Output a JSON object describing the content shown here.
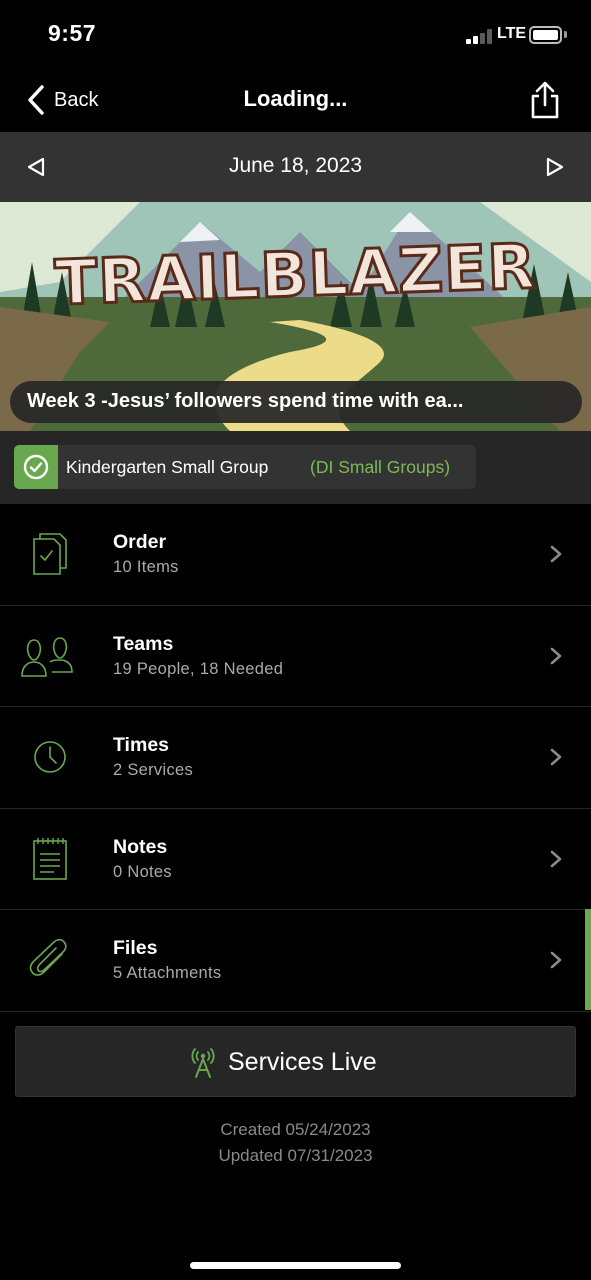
{
  "status_bar": {
    "time": "9:57",
    "network": "LTE"
  },
  "nav": {
    "back_label": "Back",
    "title": "Loading..."
  },
  "date_bar": {
    "date": "June 18, 2023"
  },
  "hero": {
    "image_text": "TRAILBLAZER",
    "caption": "Week 3 -Jesus’ followers spend  time with ea..."
  },
  "group": {
    "name": "Kindergarten Small Group",
    "parent": "(DI Small Groups)"
  },
  "rows": [
    {
      "title": "Order",
      "subtitle": "10 Items",
      "icon": "order-icon"
    },
    {
      "title": "Teams",
      "subtitle": "19 People, 18 Needed",
      "icon": "teams-icon"
    },
    {
      "title": "Times",
      "subtitle": "2 Services",
      "icon": "clock-icon"
    },
    {
      "title": "Notes",
      "subtitle": "0 Notes",
      "icon": "notes-icon"
    },
    {
      "title": "Files",
      "subtitle": "5 Attachments",
      "icon": "paperclip-icon"
    }
  ],
  "live_button": {
    "label": "Services Live",
    "icon": "broadcast-icon"
  },
  "meta": {
    "created": "Created 05/24/2023",
    "updated": "Updated 07/31/2023"
  },
  "colors": {
    "accent": "#6aa84f",
    "background": "#000000",
    "bar": "#333333"
  }
}
